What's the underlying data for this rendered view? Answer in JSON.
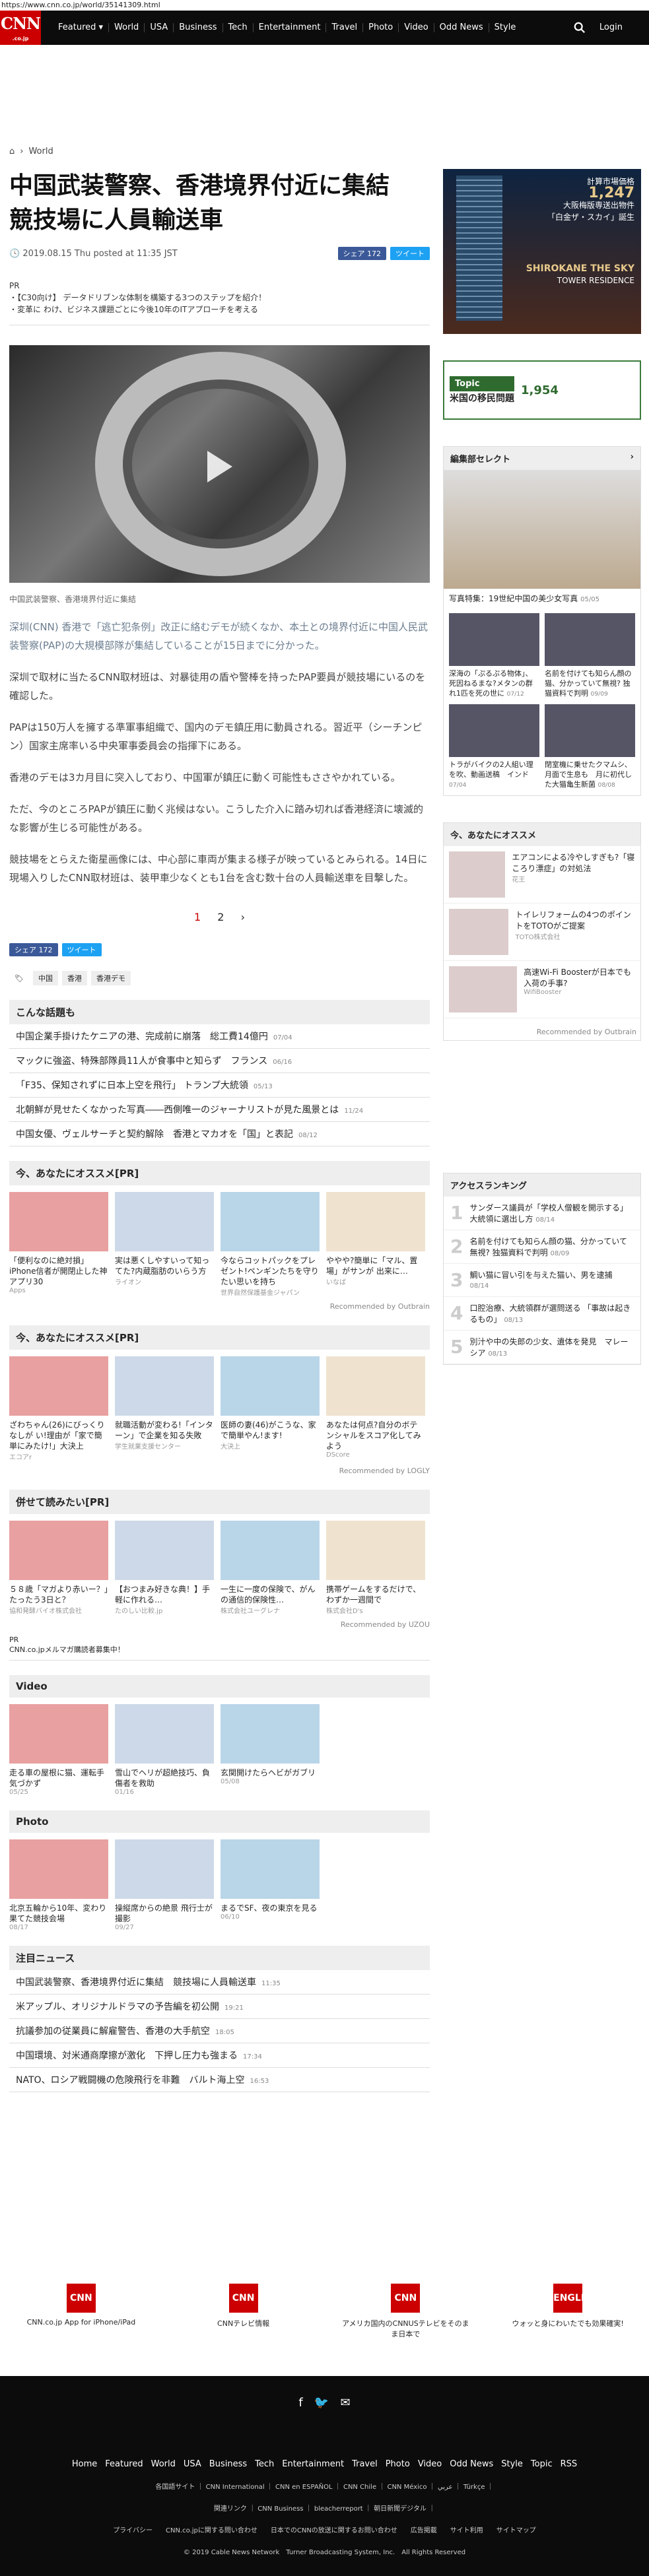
{
  "url": "https://www.cnn.co.jp/world/35141309.html",
  "logo": {
    "main": "CNN",
    "sub": ".co.jp"
  },
  "nav": [
    "Featured ▾",
    "World",
    "USA",
    "Business",
    "Tech",
    "Entertainment",
    "Travel",
    "Photo",
    "Video",
    "Odd News",
    "Style"
  ],
  "login": "Login",
  "breadcrumb": "World",
  "article": {
    "title": "中国武装警察、香港境界付近に集結　競技場に人員輸送車",
    "date": "2019.08.15 Thu posted at 11:35 JST",
    "share_fb": "シェア 172",
    "share_tw": "ツイート",
    "pr_label": "PR",
    "pr_lines": [
      "・【C30向け】 データドリブンな体制を構築する3つのステップを紹介！",
      "・変革に わけ、ビジネス課題ごとに今後10年のITアプローチを考える"
    ],
    "caption": "中国武装警察、香港境界付近に集結",
    "paragraphs": [
      "深圳(CNN) 香港で「逃亡犯条例」改正に絡むデモが続くなか、本土との境界付近に中国人民武装警察(PAP)の大規模部隊が集結していることが15日までに分かった。",
      "深圳で取材に当たるCNN取材班は、対暴徒用の盾や警棒を持ったPAP要員が競技場にいるのを確認した。",
      "PAPは150万人を擁する準軍事組織で、国内のデモ鎮圧用に動員される。習近平（シーチンピン）国家主席率いる中央軍事委員会の指揮下にある。",
      "香港のデモは3カ月目に突入しており、中国軍が鎮圧に動く可能性もささやかれている。",
      "ただ、今のところPAPが鎮圧に動く兆候はない。こうした介入に踏み切れば香港経済に壊滅的な影響が生じる可能性がある。",
      "競技場をとらえた衛星画像には、中心部に車両が集まる様子が映っているとみられる。14日に現場入りしたCNN取材班は、装甲車少なくとも1台を含む数十台の人員輸送車を目撃した。"
    ],
    "pages": [
      "1",
      "2",
      "›"
    ],
    "tags": [
      "中国",
      "香港",
      "香港デモ"
    ]
  },
  "related": {
    "title": "こんな話題も",
    "items": [
      {
        "t": "中国企業手掛けたケニアの港、完成前に崩落　総工費14億円",
        "d": "07/04"
      },
      {
        "t": "マックに強盗、特殊部隊員11人が食事中と知らず　フランス",
        "d": "06/16"
      },
      {
        "t": "「F35、保知されずに日本上空を飛行」 トランプ大統領",
        "d": "05/13"
      },
      {
        "t": "北朝鮮が見せたくなかった写真――西側唯一のジャーナリストが見た風景とは",
        "d": "11/24"
      },
      {
        "t": "中国女優、ヴェルサーチと契約解除　香港とマカオを「国」と表記",
        "d": "08/12"
      }
    ]
  },
  "osusume1": {
    "title": "今、あなたにオススメ[PR]",
    "items": [
      {
        "t": "「便利なのに絶対損」iPhone信者が開閉止した神アプリ30",
        "s": "Apps"
      },
      {
        "t": "実は悪くしやすいって知ってた?内蔵脂肪のいらう方",
        "s": "ライオン"
      },
      {
        "t": "今ならコットパックをプレゼント!ペンギンたちを守りたい思いを持ち",
        "s": "世界自然保護基金ジャパン"
      },
      {
        "t": "ややや?簡単に「マル、置場」がサンが 出来に…",
        "s": "いなば"
      }
    ],
    "rec": "Recommended by Outbrain"
  },
  "osusume2": {
    "title": "今、あなたにオススメ[PR]",
    "items": [
      {
        "t": "ざわちゃん(26)にびっくりなしが い!理由が「家で簡単にみたけ!」大決上",
        "s": "エコアr"
      },
      {
        "t": "就職活動が変わる!「インターン」で企業を知る失敗",
        "s": "学生就業支援センター"
      },
      {
        "t": "医師の妻(46)がこうな、家で簡単やん!ます!",
        "s": "大決上"
      },
      {
        "t": "あなたは何点?自分のボテンシャルをスコア化してみよう",
        "s": "DScore"
      }
    ],
    "rec": "Recommended by LOGLY"
  },
  "dokuyomi": {
    "title": "併せて読みたい[PR]",
    "items": [
      {
        "t": "５８歳「マガより赤いー？」たったう3日と？",
        "s": "協和発酵バイオ株式会社"
      },
      {
        "t": "【おつまみ好きな典！】手軽に作れる…",
        "s": "たのしい比較.jp"
      },
      {
        "t": "一生に一度の保険で、がんの通信的保険性…",
        "s": "株式会社ユーグレナ"
      },
      {
        "t": "携帯ゲームをするだけで、わずか一週間で",
        "s": "株式会社D's"
      }
    ],
    "rec": "Recommended by UZOU"
  },
  "pr2": "CNN.co.jpメルマガ購読者募集中！",
  "video": {
    "title": "Video",
    "items": [
      {
        "t": "走る車の屋根に猫、運転手気づかず",
        "d": "05/25"
      },
      {
        "t": "雪山でヘリが超絶技巧、負傷者を救助",
        "d": "01/16"
      },
      {
        "t": "玄関開けたらヘビがガブリ",
        "d": "05/08"
      }
    ]
  },
  "photo": {
    "title": "Photo",
    "items": [
      {
        "t": "北京五輪から10年、変わり果てた競技会場",
        "d": "08/17"
      },
      {
        "t": "操縦席からの絶景 飛行士が撮影",
        "d": "09/27"
      },
      {
        "t": "まるでSF、夜の東京を見る",
        "d": "06/10"
      }
    ]
  },
  "chumoku": {
    "title": "注目ニュース",
    "items": [
      {
        "t": "中国武装警察、香港境界付近に集結　競技場に人員輸送車",
        "d": "11:35"
      },
      {
        "t": "米アップル、オリジナルドラマの予告編を初公開",
        "d": "19:21"
      },
      {
        "t": "抗議参加の従業員に解雇警告、香港の大手航空",
        "d": "18:05"
      },
      {
        "t": "中国環境、対米通商摩擦が激化　下押し圧力も強まる",
        "d": "17:34"
      },
      {
        "t": "NATO、ロシア戦闘機の危険飛行を非難　バルト海上空",
        "d": "16:53"
      }
    ]
  },
  "side": {
    "ad1": {
      "l1": "計算市場価格",
      "l2": "1,247",
      "l3": "大阪梅版専送出物件",
      "l4": "「白金ザ・スカイ」誕生",
      "big": "SHIROKANE THE SKY",
      "l5": "TOWER RESIDENCE"
    },
    "ad2": {
      "label": "Topic",
      "text": "米国の移民問題",
      "num": "1,954"
    },
    "select": {
      "title": "編集部セレクト",
      "main": "写真特集：19世紀中国の美少女写真",
      "mdate": "05/05",
      "items": [
        {
          "t": "深海の「ぷるぷる物体」、死因ねるまな?メタンの群れ1匹を死の世に",
          "d": "07/12"
        },
        {
          "t": "名前を付けても知らん顔の猫、分かっていて無視? 独猫資料で判明",
          "d": "09/09"
        },
        {
          "t": "トラがバイクの2人組い理を吹、動画送稿　インド",
          "d": "07/04"
        },
        {
          "t": "閉室機に乗せたクマムシ、月面で生息も　月に初代した大猫亀生新菌",
          "d": "08/08"
        }
      ]
    },
    "oss": {
      "title": "今、あなたにオススメ",
      "items": [
        {
          "t": "エアコンによる冷やしすぎも?「寝ころり漂症」の対処法",
          "s": "花王"
        },
        {
          "t": "トイレリフォームの4つのポイントをTOTOがご提案",
          "s": "TOTO株式会社"
        },
        {
          "t": "高速Wi-Fi Boosterが日本でも入荷の手事?",
          "s": "WifiBooster"
        }
      ],
      "rec": "Recommended by Outbrain"
    },
    "ranking": {
      "title": "アクセスランキング",
      "items": [
        {
          "n": "1",
          "t": "サンダース議員が「学校人僧観を開示する」大統領に選出し方",
          "d": "08/14"
        },
        {
          "n": "2",
          "t": "名前を付けても知らん顔の猫、分かっていて無視? 独猫資料で判明",
          "d": "08/09"
        },
        {
          "n": "3",
          "t": "鯛い猫に冒い引を与えた猫い、男を逮捕",
          "d": "08/14"
        },
        {
          "n": "4",
          "t": "口腔治療、大統領群が選問送る 「事故は起きるもの」",
          "d": "08/13"
        },
        {
          "n": "5",
          "t": "別汁や中の失郎の少女、遺体を発見　マレーシア",
          "d": "08/13"
        }
      ]
    }
  },
  "apps": [
    {
      "icon": "CNN",
      "t": "CNN.co.jp App for iPhone/iPad"
    },
    {
      "icon": "CNN",
      "t": "CNNテレビ情報"
    },
    {
      "icon": "CNN",
      "t": "アメリカ国内のCNNUSテレビをそのまま日本で"
    },
    {
      "icon": "ENGLISH",
      "t": "ウォッと身にわいたでも効果確実!"
    }
  ],
  "footer": {
    "nav": [
      "Home",
      "Featured",
      "World",
      "USA",
      "Business",
      "Tech",
      "Entertainment",
      "Travel",
      "Photo",
      "Video",
      "Odd News",
      "Style",
      "Topic",
      "RSS"
    ],
    "line2": "各国語サイト ｜ CNN International ｜ CNN en ESPAÑOL ｜ CNN Chile ｜ CNN México ｜ ﻋﺮﺑﻲ ｜ Türkçe ｜",
    "line3": "関連リンク ｜ CNN Business ｜ bleacherreport ｜ 朝日新聞デジタル ｜",
    "line4": "プライバシー　　CNN.co.jpに関する問い合わせ　　日本でのCNNの放送に関するお問い合わせ　　広告掲載　　サイト利用　　サイトマップ",
    "copy": "© 2019 Cable News Network　Turner Broadcasting System, Inc.　All Rights Reserved"
  }
}
